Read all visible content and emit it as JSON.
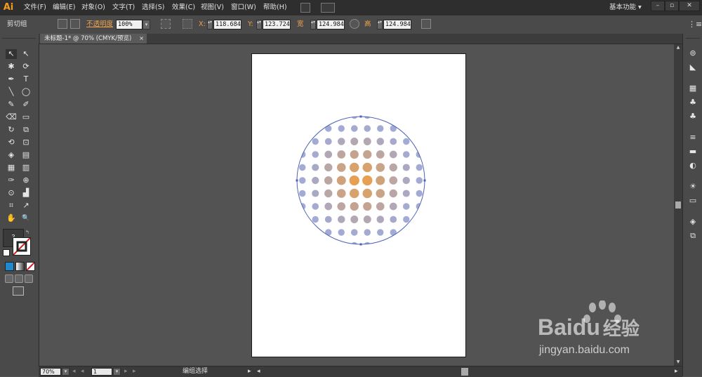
{
  "app": {
    "logo": "Ai"
  },
  "menubar": {
    "items": [
      "文件(F)",
      "编辑(E)",
      "对象(O)",
      "文字(T)",
      "选择(S)",
      "效果(C)",
      "视图(V)",
      "窗口(W)",
      "帮助(H)"
    ],
    "workspace": "基本功能",
    "workspace_arrow": "▾",
    "window_buttons": [
      "–",
      "▫",
      "✕"
    ]
  },
  "control_bar": {
    "selection_label": "剪切组",
    "opacity_label": "不透明度",
    "opacity_value": "100%",
    "x_label": "X:",
    "x_value": "118.684",
    "y_label": "Y:",
    "y_value": "123.724",
    "w_label": "宽",
    "w_value": "124.984",
    "h_label": "高",
    "h_value": "124.984",
    "spin": "▴▾",
    "dropdown": "▾"
  },
  "document_tab": {
    "title": "未标题-1* @ 70% (CMYK/预览)",
    "close": "×"
  },
  "status_bar": {
    "zoom": "70%",
    "page": "1",
    "nav_prev": "◂",
    "nav_next": "▸",
    "status_text": "编组选择",
    "arrow_right": "▸",
    "arrow_left": "◂"
  },
  "tools": [
    "↖",
    "↖",
    "✱",
    "⟳",
    "✒",
    "T",
    "╲",
    "◯",
    "✎",
    "✐",
    "⌫",
    "▭",
    "↻",
    "⧉",
    "⟲",
    "⊡",
    "◈",
    "▤",
    "▦",
    "▥",
    "✑",
    "⊕",
    "⊙",
    "▟",
    "⌗",
    "↗",
    "✋",
    "🔍",
    "?"
  ],
  "panels": [
    "⊚",
    "◣",
    "▦",
    "♣",
    "♣",
    "≡",
    "▬",
    "◐",
    "☀",
    "▭",
    "◈",
    "⧉"
  ],
  "artwork": {
    "grid_cols": 10,
    "grid_rows": 11,
    "color_center": "#f39a33",
    "color_edge": "#7c87c2",
    "outline_color": "#4a63b5"
  },
  "watermark": {
    "brand": "Bai",
    "brand2": "du",
    "product": "经验",
    "url": "jingyan.baidu.com"
  }
}
